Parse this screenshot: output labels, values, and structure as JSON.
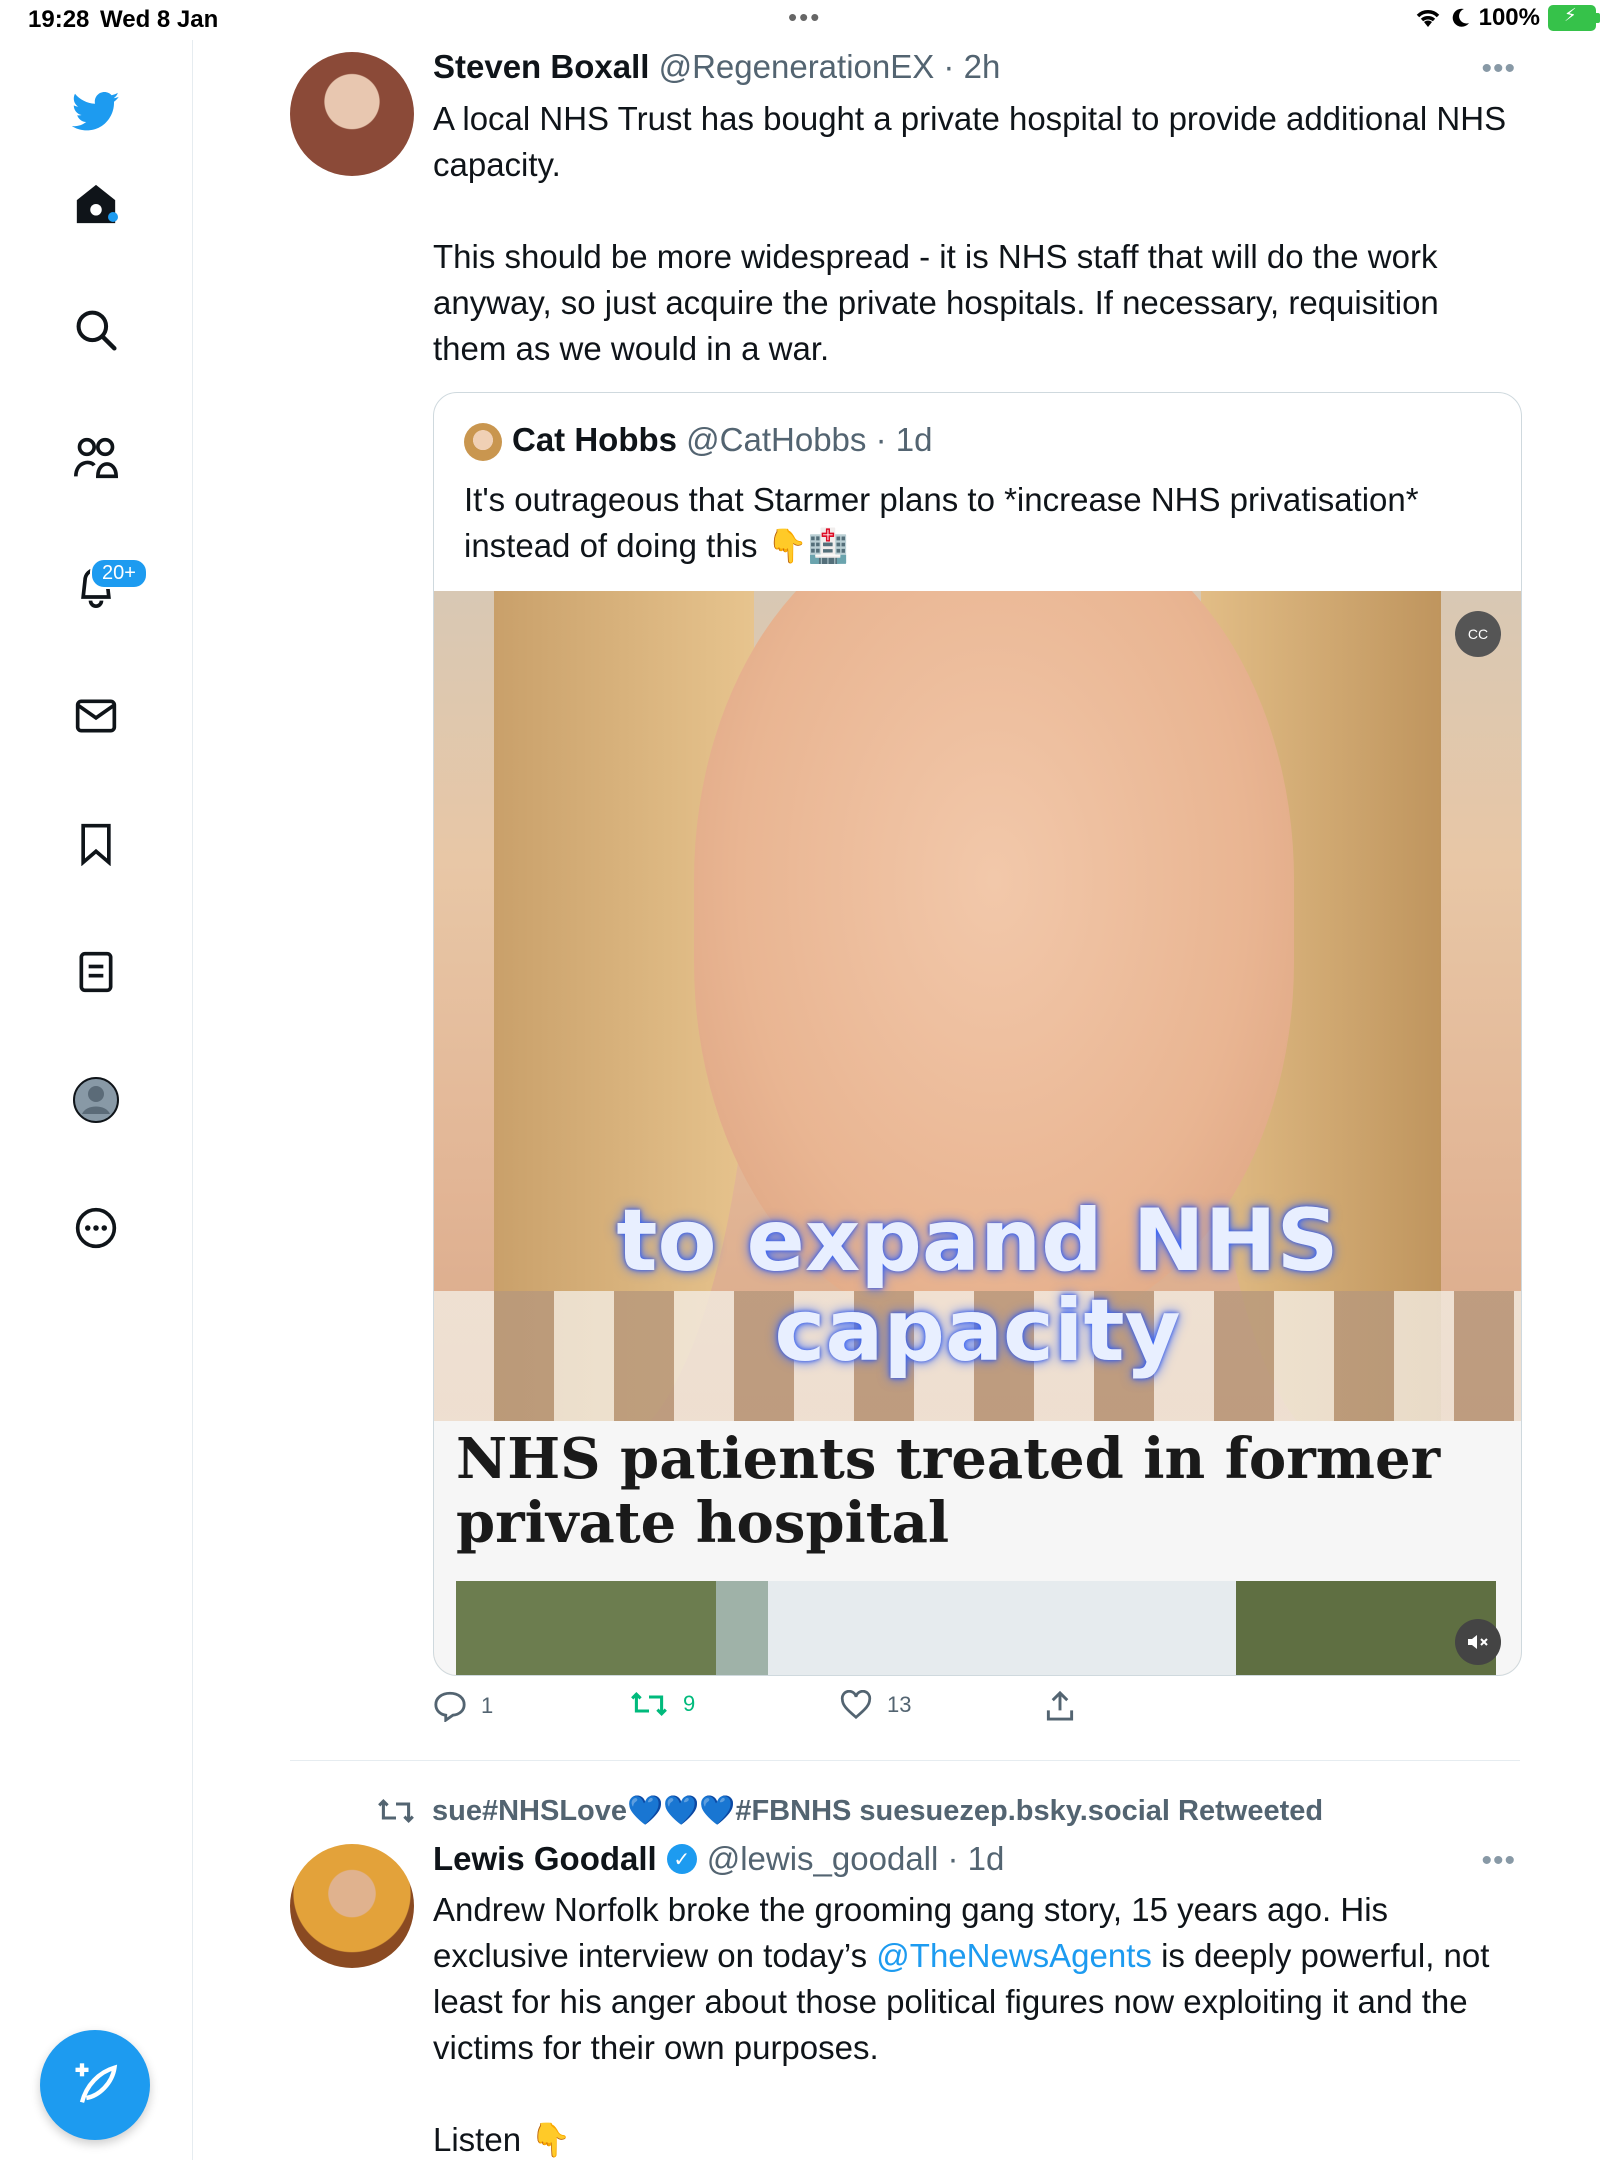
{
  "status_bar": {
    "time": "19:28",
    "date": "Wed 8 Jan",
    "battery": "100%"
  },
  "sidebar": {
    "notifications_badge": "20+",
    "items": [
      "home",
      "search",
      "communities",
      "notifications",
      "messages",
      "bookmarks",
      "lists",
      "profile",
      "more"
    ]
  },
  "tweet1": {
    "name": "Steven Boxall",
    "handle": "@RegenerationEX · 2h",
    "text": "A local NHS Trust has bought a private hospital to provide additional NHS capacity.\n\nThis should be more widespread - it is NHS staff that will do the work anyway, so just acquire the private hospitals. If necessary, requisition them as we would in a war.",
    "quote": {
      "name": "Cat Hobbs",
      "handle": "@CatHobbs · 1d",
      "text": "It's outrageous that Starmer plans to *increase NHS privatisation* instead of doing this 👇🏥",
      "caption_line1": "to expand NHS",
      "caption_line2": "capacity",
      "headline": "NHS patients treated in former private hospital",
      "cc_label": "CC"
    },
    "actions": {
      "replies": "1",
      "retweets": "9",
      "likes": "13"
    }
  },
  "tweet2": {
    "retweeted_by": "sue#NHSLove💙💙💙#FBNHS suesuezep.bsky.social Retweeted",
    "name": "Lewis Goodall",
    "handle": "@lewis_goodall · 1d",
    "text_before_link": "Andrew Norfolk broke the grooming gang story, 15 years ago. His exclusive interview on today’s ",
    "link": "@TheNewsAgents",
    "text_after_link": " is deeply powerful, not least for his anger about those political figures now exploiting it and the victims for their own purposes.",
    "text_listen": "Listen 👇"
  },
  "colors": {
    "accent": "#1d9bf0",
    "retweet": "#00ba7c",
    "muted": "#536471"
  }
}
